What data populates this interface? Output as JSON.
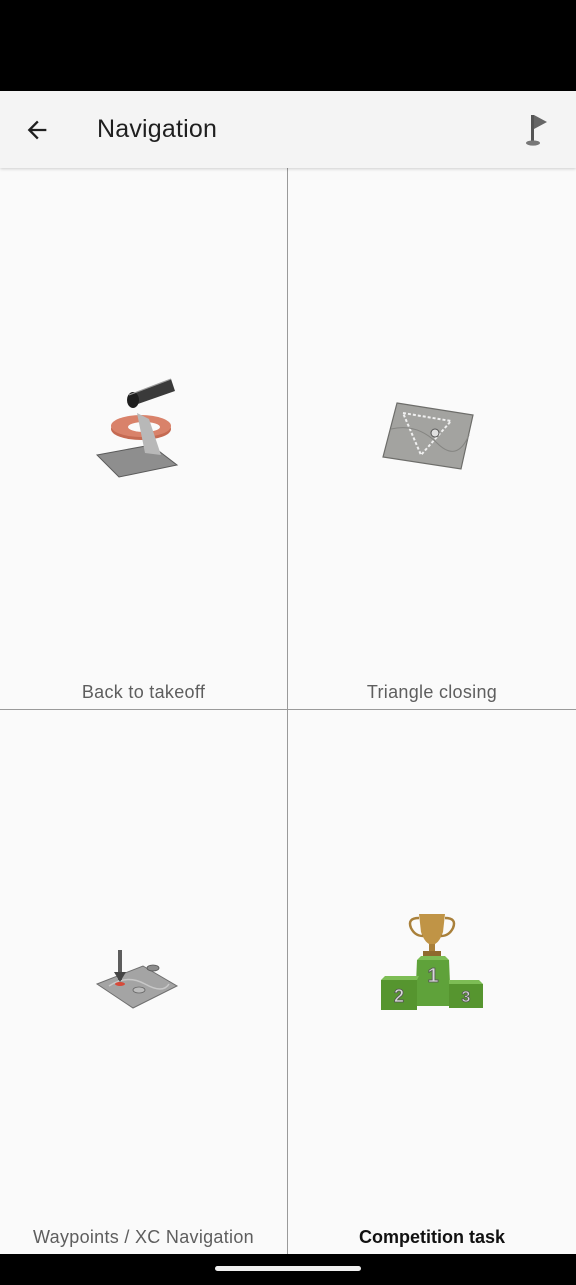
{
  "app_bar": {
    "title": "Navigation",
    "back_icon": "arrow-back-icon",
    "action_icon": "flag-icon"
  },
  "tiles": [
    {
      "label": "Back to takeoff",
      "icon": "back-to-takeoff-icon",
      "selected": false
    },
    {
      "label": "Triangle closing",
      "icon": "triangle-closing-icon",
      "selected": false
    },
    {
      "label": "Waypoints / XC Navigation",
      "icon": "waypoints-icon",
      "selected": false
    },
    {
      "label": "Competition task",
      "icon": "trophy-podium-icon",
      "selected": true
    }
  ],
  "podium": {
    "first": "1",
    "second": "2",
    "third": "3"
  },
  "colors": {
    "app_bar_bg": "#f4f4f4",
    "grid_bg": "#fafafa",
    "divider": "#9a9a9a",
    "podium_green": "#5fa23a",
    "trophy_gold": "#b8893a"
  }
}
